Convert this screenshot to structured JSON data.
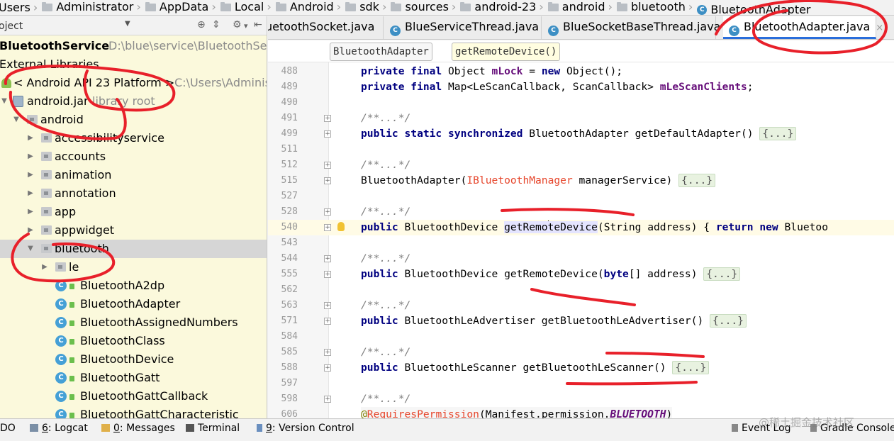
{
  "breadcrumb": [
    "Users",
    "Administrator",
    "AppData",
    "Local",
    "Android",
    "sdk",
    "sources",
    "android-23",
    "android",
    "bluetooth",
    "BluetoothAdapter"
  ],
  "project": {
    "view_label": "oject",
    "tree": [
      {
        "label": "BluetoothService",
        "hint": "D:\\blue\\service\\BluetoothServi",
        "indent": 0
      },
      {
        "label": "External Libraries",
        "hint": "",
        "indent": 0
      },
      {
        "label": "< Android API 23 Platform >",
        "hint": "C:\\Users\\Adminis",
        "indent": 1
      },
      {
        "label": "android.jar",
        "hint": "library root",
        "indent": 1
      },
      {
        "label": "android",
        "hint": "",
        "indent": 2
      },
      {
        "label": "accessibilityservice",
        "hint": "",
        "indent": 3
      },
      {
        "label": "accounts",
        "hint": "",
        "indent": 3
      },
      {
        "label": "animation",
        "hint": "",
        "indent": 3
      },
      {
        "label": "annotation",
        "hint": "",
        "indent": 3
      },
      {
        "label": "app",
        "hint": "",
        "indent": 3
      },
      {
        "label": "appwidget",
        "hint": "",
        "indent": 3
      },
      {
        "label": "bluetooth",
        "hint": "",
        "indent": 3
      },
      {
        "label": "le",
        "hint": "",
        "indent": 4
      },
      {
        "label": "BluetoothA2dp",
        "hint": "",
        "indent": 4
      },
      {
        "label": "BluetoothAdapter",
        "hint": "",
        "indent": 4
      },
      {
        "label": "BluetoothAssignedNumbers",
        "hint": "",
        "indent": 4
      },
      {
        "label": "BluetoothClass",
        "hint": "",
        "indent": 4
      },
      {
        "label": "BluetoothDevice",
        "hint": "",
        "indent": 4
      },
      {
        "label": "BluetoothGatt",
        "hint": "",
        "indent": 4
      },
      {
        "label": "BluetoothGattCallback",
        "hint": "",
        "indent": 4
      },
      {
        "label": "BluetoothGattCharacteristic",
        "hint": "",
        "indent": 4
      }
    ]
  },
  "tabs": [
    {
      "label": "uetoothSocket.java",
      "active": false
    },
    {
      "label": "BlueServiceThread.java",
      "active": false
    },
    {
      "label": "BlueSocketBaseThread.java",
      "active": false
    },
    {
      "label": "BluetoothAdapter.java",
      "active": true
    }
  ],
  "editor_crumbs": [
    "BluetoothAdapter",
    "getRemoteDevice()"
  ],
  "lines": [
    {
      "num": "488",
      "fold": false
    },
    {
      "num": "489",
      "fold": false
    },
    {
      "num": "490",
      "fold": false
    },
    {
      "num": "491",
      "fold": true
    },
    {
      "num": "499",
      "fold": true
    },
    {
      "num": "511",
      "fold": false
    },
    {
      "num": "512",
      "fold": true
    },
    {
      "num": "515",
      "fold": true
    },
    {
      "num": "527",
      "fold": false
    },
    {
      "num": "528",
      "fold": true
    },
    {
      "num": "540",
      "fold": true
    },
    {
      "num": "543",
      "fold": false
    },
    {
      "num": "544",
      "fold": true
    },
    {
      "num": "555",
      "fold": true
    },
    {
      "num": "562",
      "fold": false
    },
    {
      "num": "563",
      "fold": true
    },
    {
      "num": "571",
      "fold": true
    },
    {
      "num": "584",
      "fold": false
    },
    {
      "num": "585",
      "fold": true
    },
    {
      "num": "588",
      "fold": true
    },
    {
      "num": "597",
      "fold": false
    },
    {
      "num": "598",
      "fold": true
    },
    {
      "num": "606",
      "fold": false
    }
  ],
  "code": {
    "l488": [
      "private final",
      " Object ",
      "mLock",
      " = ",
      "new",
      " Object();"
    ],
    "l489": [
      "private final",
      " Map<LeScanCallback, ScanCallback> ",
      "mLeScanClients",
      ";"
    ],
    "comment": "/**...*/",
    "l499": [
      "public static synchronized",
      " BluetoothAdapter getDefaultAdapter() ",
      "{...}"
    ],
    "l515": [
      "BluetoothAdapter(",
      "IBluetoothManager",
      " managerService) ",
      "{...}"
    ],
    "l540": [
      "public",
      " BluetoothDevice ",
      "getRemo",
      "teDevice",
      "(String address) { ",
      "return new",
      " Bluetoo"
    ],
    "l555": [
      "public",
      " BluetoothDevice getRemoteDevice(",
      "byte",
      "[] address) ",
      "{...}"
    ],
    "l571": [
      "public",
      " BluetoothLeAdvertiser getBluetoothLeAdvertiser() ",
      "{...}"
    ],
    "l588": [
      "public",
      " BluetoothLeScanner getBluetoothLeScanner() ",
      "{...}"
    ],
    "l606": [
      "@",
      "RequiresPermission",
      "(Manifest.permission.",
      "BLUETOOTH",
      ")"
    ]
  },
  "status_bar": [
    {
      "label": "DO",
      "key": ""
    },
    {
      "label": ": Logcat",
      "key": "6"
    },
    {
      "label": ": Messages",
      "key": "0"
    },
    {
      "label": "Terminal",
      "key": ""
    },
    {
      "label": ": Version Control",
      "key": "9"
    },
    {
      "label": "Event Log",
      "key": ""
    },
    {
      "label": "Gradle Console",
      "key": ""
    }
  ],
  "watermark": "@稀土掘金技术社区",
  "colors": {
    "annotation_red": "#e8202a",
    "active_tab_underline": "#2a6edb",
    "project_bg": "#fbf9dc"
  }
}
